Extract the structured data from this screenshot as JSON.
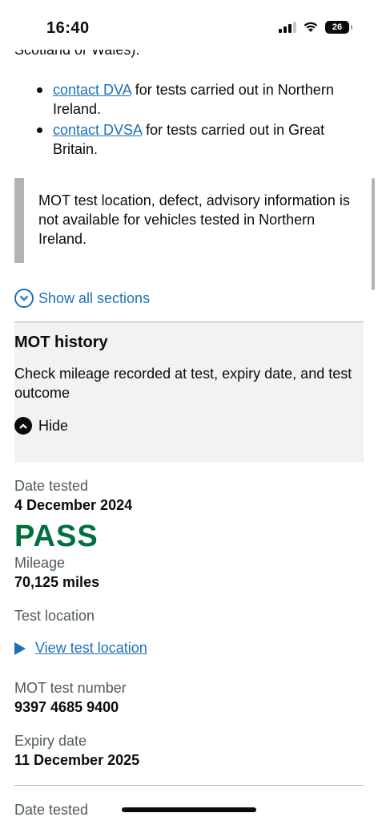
{
  "status_bar": {
    "time": "16:40",
    "battery": "26"
  },
  "page": {
    "cut_text": "Scotland or Wales).",
    "bullets": [
      {
        "link": "contact DVA",
        "text": " for tests carried out in Northern Ireland."
      },
      {
        "link": "contact DVSA",
        "text": " for tests carried out in Great Britain."
      }
    ],
    "inset_text": "MOT test location, defect, advisory information is not available for vehicles tested in Northern Ireland.",
    "show_all": "Show all sections"
  },
  "section": {
    "title": "MOT history",
    "summary": "Check mileage recorded at test, expiry date, and test outcome",
    "hide_label": "Hide"
  },
  "test_record": {
    "date_label": "Date tested",
    "date_value": "4 December 2024",
    "result": "PASS",
    "mileage_label": "Mileage",
    "mileage_value": "70,125 miles",
    "location_label": "Test location",
    "location_link": "View test location",
    "number_label": "MOT test number",
    "number_value": "9397 4685 9400",
    "expiry_label": "Expiry date",
    "expiry_value": "11 December 2025"
  },
  "next_record": {
    "date_label": "Date tested"
  },
  "colors": {
    "link": "#1d70b8",
    "pass": "#00703c",
    "panel": "#f3f2f1",
    "inset_border": "#b1b4b6"
  }
}
